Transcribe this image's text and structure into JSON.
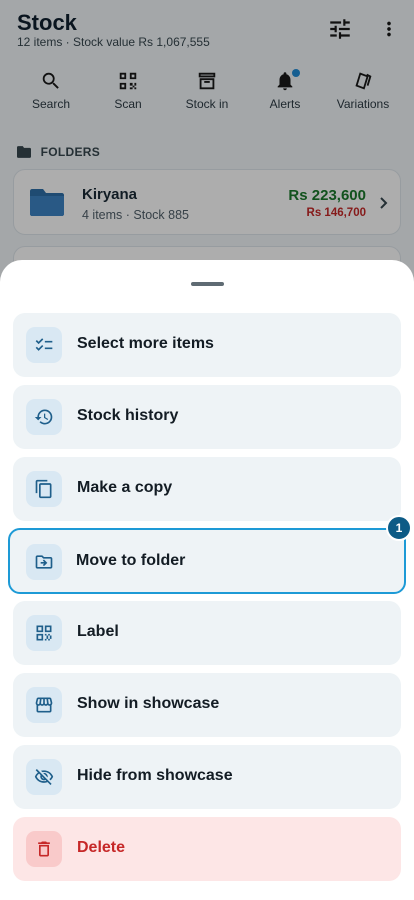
{
  "header": {
    "title": "Stock",
    "subtitle": "12 items · Stock value Rs 1,067,555",
    "filter_icon": "tune-icon",
    "more_icon": "more-vert-icon"
  },
  "quick_actions": [
    {
      "label": "Search",
      "icon": "search-icon"
    },
    {
      "label": "Scan",
      "icon": "qr-scan-icon"
    },
    {
      "label": "Stock in",
      "icon": "archive-icon"
    },
    {
      "label": "Alerts",
      "icon": "bell-icon",
      "has_dot": true
    },
    {
      "label": "Variations",
      "icon": "variations-icon"
    }
  ],
  "folders": {
    "heading": "FOLDERS",
    "items": [
      {
        "name": "Kiryana",
        "meta": "4 items · Stock 885",
        "value": "Rs 223,600",
        "cost": "Rs 146,700"
      }
    ]
  },
  "sheet": {
    "options": [
      {
        "label": "Select more items",
        "icon": "checklist-icon"
      },
      {
        "label": "Stock history",
        "icon": "history-icon"
      },
      {
        "label": "Make a copy",
        "icon": "copy-icon"
      },
      {
        "label": "Move to folder",
        "icon": "move-to-folder-icon",
        "highlighted": true
      },
      {
        "label": "Label",
        "icon": "qr-label-icon"
      },
      {
        "label": "Show in showcase",
        "icon": "storefront-icon"
      },
      {
        "label": "Hide from showcase",
        "icon": "visibility-off-icon"
      },
      {
        "label": "Delete",
        "icon": "trash-icon",
        "danger": true
      }
    ],
    "step_badge": "1"
  },
  "colors": {
    "accent": "#1d9ad6",
    "icon_blue": "#1f5f8b",
    "positive": "#1b7a2c",
    "danger": "#c62828"
  }
}
